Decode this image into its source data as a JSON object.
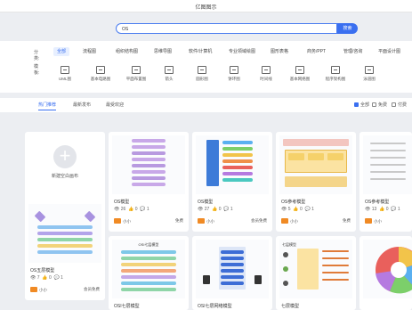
{
  "window": {
    "title": "亿图图示"
  },
  "search": {
    "value": "OS",
    "button": "搜索"
  },
  "categories": {
    "label": "分类:",
    "items": [
      "全部",
      "流程图",
      "组织结构图",
      "思维导图",
      "软件/计算机",
      "专业领域绘图",
      "图形表格",
      "商务/PPT",
      "管理/咨询",
      "平面设计图"
    ],
    "active_index": 0
  },
  "templates": {
    "label": "模板:",
    "items": [
      "UML图",
      "基本电路图",
      "平面布置图",
      "箭头",
      "圆形图",
      "饼环图",
      "时间线",
      "基本网络图",
      "程序架构图",
      "泳道图"
    ]
  },
  "tabs": {
    "items": [
      "热门推荐",
      "最新发布",
      "最受欢迎"
    ],
    "active_index": 0
  },
  "filters": {
    "all": "全部",
    "free": "免费",
    "paid": "付费"
  },
  "new_card": {
    "label": "新建空白画布"
  },
  "cards": [
    {
      "title": "OS模型",
      "views": "26",
      "likes": "0",
      "comments": "1",
      "author": "小小",
      "price": "免费"
    },
    {
      "title": "OS模型",
      "views": "27",
      "likes": "0",
      "comments": "1",
      "author": "小小",
      "price": "会员免费"
    },
    {
      "title": "OS参考模型",
      "views": "5",
      "likes": "0",
      "comments": "1",
      "author": "小小",
      "price": "免费"
    },
    {
      "title": "OS参考模型",
      "views": "13",
      "likes": "0",
      "comments": "1",
      "author": "小小",
      "price": ""
    },
    {
      "title": "OS五层模型",
      "views": "7",
      "likes": "0",
      "comments": "1",
      "author": "小小",
      "price": "会员免费"
    },
    {
      "title": "OSI七层模型",
      "views": "",
      "likes": "",
      "comments": "",
      "author": "",
      "price": ""
    },
    {
      "title": "OSI七层网络模型",
      "views": "",
      "likes": "",
      "comments": "",
      "author": "",
      "price": ""
    },
    {
      "title": "七层模型",
      "views": "",
      "likes": "",
      "comments": "",
      "author": "",
      "price": ""
    }
  ],
  "thumb_texts": {
    "osi7": "OSI七层模型",
    "seven": "七层模型"
  },
  "colors": {
    "accent": "#3a6ff0",
    "brand_orange": "#f08a24"
  }
}
